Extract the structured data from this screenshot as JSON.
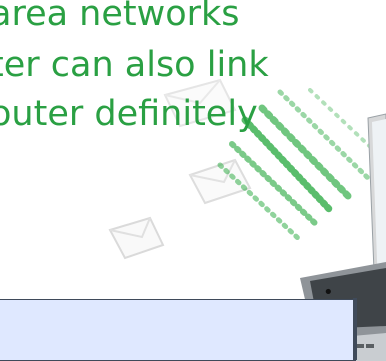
{
  "slide": {
    "lines": [
      "area networks",
      "ter can also link",
      "outer definitely"
    ],
    "colors": {
      "text": "#2aa043",
      "box_fill": "#dfe8ff",
      "box_border": "#3f4a5a"
    },
    "icons": {
      "envelope": "envelope-icon",
      "laptop": "laptop-icon"
    }
  }
}
